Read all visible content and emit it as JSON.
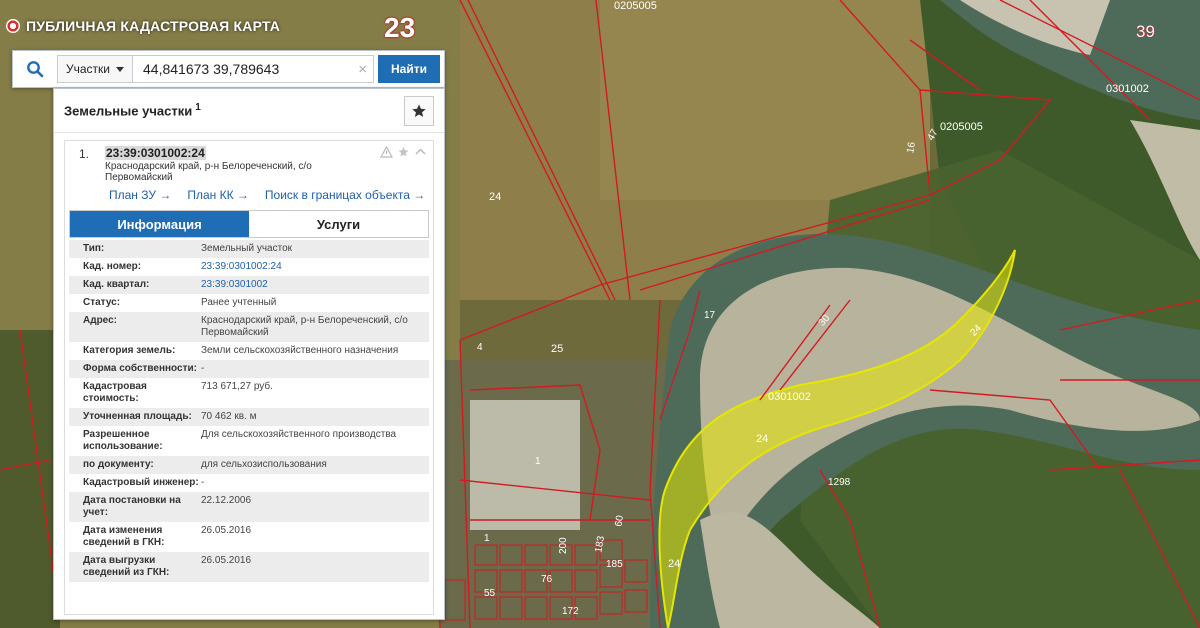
{
  "header": {
    "app_title": "ПУБЛИЧНАЯ КАДАСТРОВАЯ КАРТА",
    "region_number": "23"
  },
  "search": {
    "type_label": "Участки",
    "query": "44,841673 39,789643",
    "clear_symbol": "×",
    "button_label": "Найти"
  },
  "panel": {
    "title": "Земельные участки",
    "count": "1",
    "result": {
      "index": "1.",
      "cad_number": "23:39:0301002:24",
      "address": "Краснодарский край, р-н Белореченский, с/о Первомайский",
      "links": {
        "plan_zu": "План ЗУ →",
        "plan_kk": "План КК →",
        "search_bounds": "Поиск в границах объекта →"
      }
    },
    "tabs": {
      "info": "Информация",
      "services": "Услуги"
    },
    "rows": [
      {
        "key": "Тип:",
        "value": "Земельный участок"
      },
      {
        "key": "Кад. номер:",
        "value": "23:39:0301002:24"
      },
      {
        "key": "Кад. квартал:",
        "value": "23:39:0301002"
      },
      {
        "key": "Статус:",
        "value": "Ранее учтенный"
      },
      {
        "key": "Адрес:",
        "value": "Краснодарский край, р-н Белореченский, с/о Первомайский"
      },
      {
        "key": "Категория земель:",
        "value": "Земли сельскохозяйственного назначения"
      },
      {
        "key": "Форма собственности:",
        "value": "-"
      },
      {
        "key": "Кадастровая стоимость:",
        "value": "713 671,27 руб."
      },
      {
        "key": "Уточненная площадь:",
        "value": "70 462 кв. м"
      },
      {
        "key": "Разрешенное использование:",
        "value": "Для сельскохозяйственного производства"
      },
      {
        "key": "по документу:",
        "value": "для сельхозиспользования"
      },
      {
        "key": "Кадастровый инженер:",
        "value": "-"
      },
      {
        "key": "Дата постановки на учет:",
        "value": "22.12.2006"
      },
      {
        "key": "Дата изменения сведений в ГКН:",
        "value": "26.05.2016"
      },
      {
        "key": "Дата выгрузки сведений из ГКН:",
        "value": "26.05.2016"
      }
    ]
  },
  "map": {
    "labels": {
      "q0205005_top": "0205005",
      "q0205005_mid": "0205005",
      "q0301002_right": "0301002",
      "q0301002_center": "0301002",
      "n39": "39",
      "n16": "16",
      "n47": "47",
      "n24_a": "24",
      "n17": "17",
      "n30": "30",
      "n4": "4",
      "n25": "25",
      "n1_a": "1",
      "n1_b": "1",
      "n24_sel_top": "24",
      "n24_sel_mid": "24",
      "n24_sel_bot": "24",
      "n1298": "1298",
      "n200": "200",
      "n183": "183",
      "n185": "185",
      "n76": "76",
      "n55": "55",
      "n172": "172",
      "n60": "60"
    },
    "colors": {
      "boundary": "#d21a22",
      "selected_fill": "#e6e600",
      "river": "#4e6b5a",
      "sand": "#b8b39c"
    }
  },
  "icons": {
    "search": "search-icon",
    "favorite": "star-icon",
    "warning": "warning-icon",
    "star_small": "star-icon",
    "collapse": "chevron-up-icon"
  }
}
